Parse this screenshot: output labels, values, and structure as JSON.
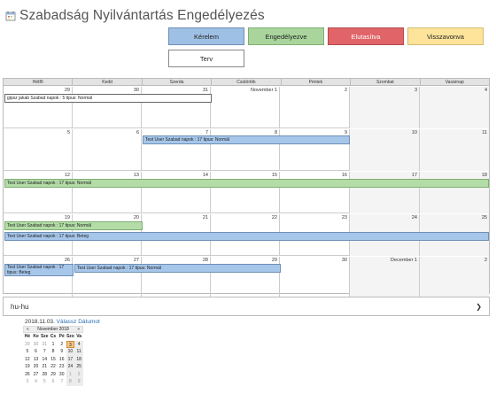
{
  "title": "Szabadság Nyilvántartás Engedélyezés",
  "legend": {
    "kerelem": "Kérelem",
    "engedelyezve": "Engedélyezve",
    "elutasitva": "Elutasítva",
    "visszavonva": "Visszavonva",
    "terv": "Terv"
  },
  "colors": {
    "kerelem": "#9fc0e5",
    "engedelyezve": "#a9d59c",
    "elutasitva": "#e06468",
    "visszavonva": "#fde49a",
    "terv": "#ffffff"
  },
  "calendar": {
    "days": [
      "Hétfő",
      "Kedd",
      "Szerda",
      "Csütörtök",
      "Péntek",
      "Szombat",
      "Vasárnap"
    ],
    "weeks": [
      [
        "29",
        "30",
        "31",
        "November 1",
        "2",
        "3",
        "4"
      ],
      [
        "5",
        "6",
        "7",
        "8",
        "9",
        "10",
        "11"
      ],
      [
        "12",
        "13",
        "14",
        "15",
        "16",
        "17",
        "18"
      ],
      [
        "19",
        "20",
        "21",
        "22",
        "23",
        "24",
        "25"
      ],
      [
        "26",
        "27",
        "28",
        "29",
        "30",
        "December 1",
        "2"
      ]
    ],
    "events": {
      "w1": "gipsz jakab Szabad napok : 5 tipus: Normál",
      "w2": "Test User Szabad napok : 17 tipus: Normál",
      "w3": "Test User Szabad napok : 17 tipus: Normál",
      "w4a": "Test User Szabad napok : 17 tipus: Normál",
      "w4b": "Test User Szabad napok : 17 tipus: Beteg",
      "w5a": "Test User Szabad napok : 17 tipus: Beteg",
      "w5b": "Test User Szabad napok : 17 tipus: Normál"
    }
  },
  "locale": {
    "value": "hu-hu"
  },
  "selected_date": {
    "date": "2018.11.03.",
    "link": "Válassz Dátumot"
  },
  "mini_calendar": {
    "month": "November 2018",
    "prev": "«",
    "next": "»",
    "dow": [
      "Hé",
      "Ke",
      "Sze",
      "Cs",
      "Pé",
      "Szo",
      "Va"
    ],
    "rows": [
      [
        "29",
        "30",
        "31",
        "1",
        "2",
        "3",
        "4"
      ],
      [
        "5",
        "6",
        "7",
        "8",
        "9",
        "10",
        "11"
      ],
      [
        "12",
        "13",
        "14",
        "15",
        "16",
        "17",
        "18"
      ],
      [
        "19",
        "20",
        "21",
        "22",
        "23",
        "24",
        "25"
      ],
      [
        "26",
        "27",
        "28",
        "29",
        "30",
        "1",
        "2"
      ],
      [
        "3",
        "4",
        "5",
        "6",
        "7",
        "8",
        "9"
      ]
    ]
  }
}
